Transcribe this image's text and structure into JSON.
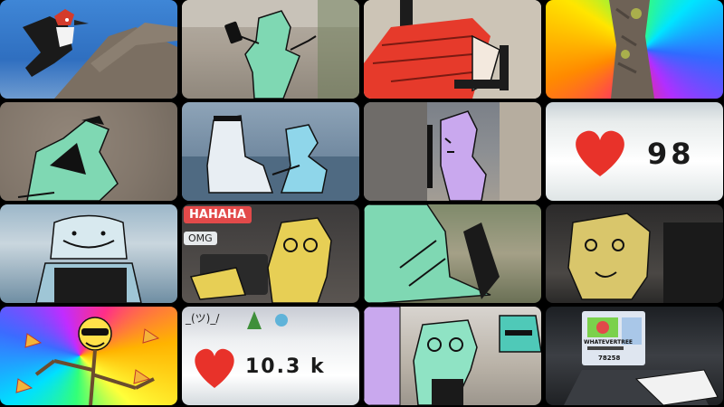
{
  "tiles": {
    "hahaha_label": "HAHAHA",
    "omg_label": "OMG",
    "likes_small": "98",
    "likes_large": "10.3 k",
    "shrug_text": "_(ツ)_/",
    "laptop_badge": "WHATEVERTREE",
    "laptop_count": "78258"
  },
  "colors": {
    "heart": "#e8322a",
    "mint_paper": "#6fd1a8",
    "lavender_paper": "#c9a8ee",
    "yellow_paper": "#e7cf55",
    "red_paper": "#e63a2b",
    "hahaha_bg": "#e24a4a"
  }
}
